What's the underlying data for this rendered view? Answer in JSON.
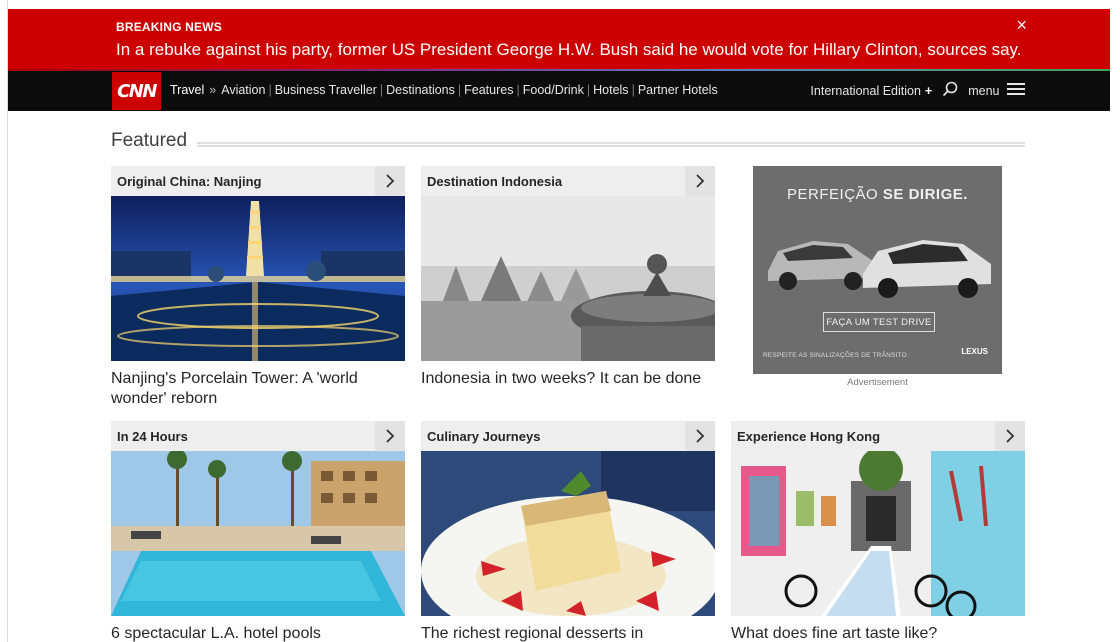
{
  "breaking": {
    "label": "BREAKING NEWS",
    "text": "In a rebuke against his party, former US President George H.W. Bush said he would vote for Hillary Clinton, sources say.",
    "close": "×"
  },
  "nav": {
    "logo": "CNN",
    "section": "Travel",
    "separator": "»",
    "links": [
      "Aviation",
      "Business Traveller",
      "Destinations",
      "Features",
      "Food/Drink",
      "Hotels",
      "Partner Hotels"
    ],
    "edition": "International Edition",
    "edition_plus": "+",
    "menu": "menu"
  },
  "featured": {
    "heading": "Featured"
  },
  "cards": [
    {
      "title": "Original China: Nanjing",
      "caption": "Nanjing's Porcelain Tower: A 'world wonder' reborn"
    },
    {
      "title": "Destination Indonesia",
      "caption": "Indonesia in two weeks? It can be done"
    },
    {
      "title": "In 24 Hours",
      "caption": "6 spectacular L.A. hotel pools"
    },
    {
      "title": "Culinary Journeys",
      "caption": "The richest regional desserts in"
    },
    {
      "title": "Experience Hong Kong",
      "caption": "What does fine art taste like?"
    }
  ],
  "ad": {
    "headline_light": "PERFEIÇÃO",
    "headline_bold": "SE DIRIGE.",
    "button": "FAÇA UM TEST DRIVE",
    "footer": "RESPEITE AS SINALIZAÇÕES DE TRÂNSITO",
    "brand": "LEXUS",
    "label": "Advertisement"
  },
  "colors": {
    "breaking_red": "#cc0000",
    "nav_bg": "#0c0c0c",
    "card_header_bg": "#eeeeee"
  }
}
